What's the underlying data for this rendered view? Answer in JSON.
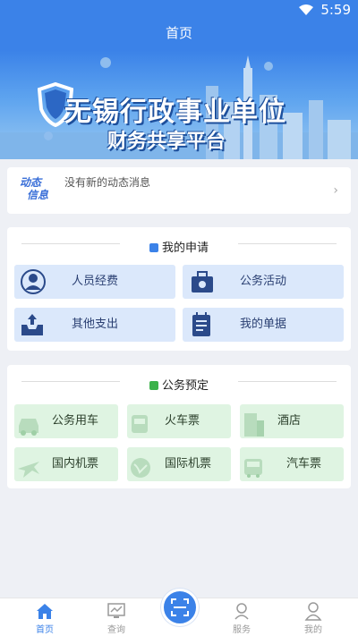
{
  "status_bar": {
    "time": "5:59"
  },
  "header": {
    "title": "首页"
  },
  "banner": {
    "title": "无锡行政事业单位",
    "subtitle": "财务共享平台"
  },
  "notice": {
    "logo_line1": "动态",
    "logo_line2": "信息",
    "message": "没有新的动态消息"
  },
  "my_application": {
    "title": "我的申请",
    "items": [
      "人员经费",
      "公务活动",
      "其他支出",
      "我的单据"
    ]
  },
  "official_booking": {
    "title": "公务预定",
    "items": [
      "公务用车",
      "火车票",
      "酒店",
      "国内机票",
      "国际机票",
      "汽车票"
    ]
  },
  "bottom_nav": {
    "items": [
      "首页",
      "查询",
      "服务",
      "我的"
    ]
  },
  "colors": {
    "primary": "#3b82e8",
    "tile_blue": "#dbe8fb",
    "tile_green": "#dff4e2"
  }
}
